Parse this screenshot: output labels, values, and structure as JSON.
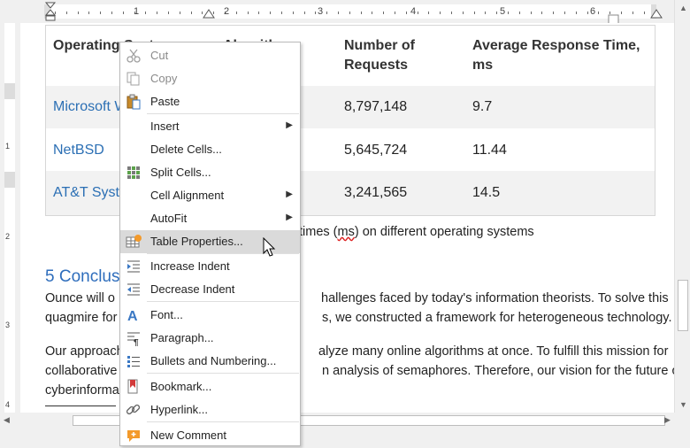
{
  "ruler": {
    "numbers": [
      "1",
      "2",
      "3",
      "4",
      "5",
      "6"
    ]
  },
  "left_ruler": {
    "numbers": [
      "1",
      "2",
      "3",
      "4"
    ]
  },
  "table": {
    "headers": {
      "col1": "Operating Syst",
      "col2": "Algorith",
      "col3_line1": "Number of",
      "col3_line2": "Requests",
      "col4_line1": "Average Response Time,",
      "col4_line2": "ms"
    },
    "rows": [
      {
        "os": "Microsoft W",
        "requests": "8,797,148",
        "time": "9.7"
      },
      {
        "os": "NetBSD",
        "requests": "5,645,724",
        "time": "11.44"
      },
      {
        "os": "AT&T Syste",
        "requests": "3,241,565",
        "time": "14.5"
      }
    ]
  },
  "caption": {
    "before": "times (",
    "squig": "ms",
    "after": ") on different operating systems"
  },
  "section_heading": "5 Conclus",
  "paragraphs": [
    {
      "left": "Ounce will o",
      "right": "hallenges faced by today's information theorists. To solve this"
    },
    {
      "left": "quagmire for",
      "right": "s, we constructed a framework for heterogeneous technology."
    },
    {
      "left": "Our approach",
      "right": "alyze many online algorithms at once. To fulfill this mission for"
    },
    {
      "left": "collaborative",
      "right": "n analysis of semaphores. Therefore, our vision for the future of"
    },
    {
      "left": "cyberinforma",
      "right": ""
    }
  ],
  "menu": {
    "cut": "Cut",
    "copy": "Copy",
    "paste": "Paste",
    "insert": "Insert",
    "delete_cells": "Delete Cells...",
    "split_cells": "Split Cells...",
    "cell_alignment": "Cell Alignment",
    "autofit": "AutoFit",
    "table_properties": "Table Properties...",
    "increase_indent": "Increase Indent",
    "decrease_indent": "Decrease Indent",
    "font": "Font...",
    "paragraph": "Paragraph...",
    "bullets": "Bullets and Numbering...",
    "bookmark": "Bookmark...",
    "hyperlink": "Hyperlink...",
    "new_comment": "New Comment"
  },
  "colors": {
    "link": "#2b6fb4",
    "heading": "#2e6dbc",
    "highlight": "#dadada",
    "accent_orange": "#f39a2b"
  }
}
